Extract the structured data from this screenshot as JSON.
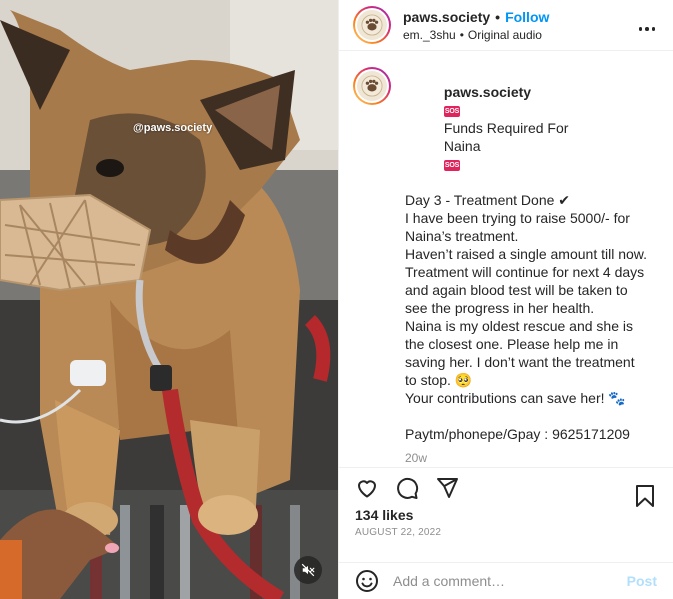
{
  "post": {
    "username": "paws.society",
    "follow_label": "Follow",
    "separator": "•",
    "audio_user": "em._3shu",
    "audio_label": "Original audio",
    "watermark": "@paws.society"
  },
  "caption": {
    "username": "paws.society",
    "sos_badge": "SOS",
    "line1_a": "Funds Required For",
    "line1_b": "Naina",
    "body": "Day 3 - Treatment Done ✔\nI have been trying to raise 5000/- for Naina’s treatment.\nHaven’t raised a single amount till now. Treatment will continue for next 4 days and again blood test will be taken to see the progress in her health.\nNaina is my oldest rescue and she is the closest one. Please help me in saving her. I don’t want the treatment to stop. 🥺\nYour contributions can save her! 🐾\n\nPaytm/phonepe/Gpay : 9625171209",
    "age": "20w"
  },
  "stats": {
    "likes": "134 likes",
    "date": "AUGUST 22, 2022"
  },
  "comment": {
    "placeholder": "Add a comment…",
    "post_label": "Post"
  },
  "icons": {
    "more": "more-options-icon",
    "like": "heart-icon",
    "comment": "comment-icon",
    "share": "share-icon",
    "save": "bookmark-icon",
    "emoji": "emoji-icon",
    "mute": "muted-speaker-icon"
  },
  "colors": {
    "accent": "#0095f6",
    "post_disabled": "#b2dffc",
    "muted_text": "#8e8e8e",
    "sos": "#e0245e"
  }
}
